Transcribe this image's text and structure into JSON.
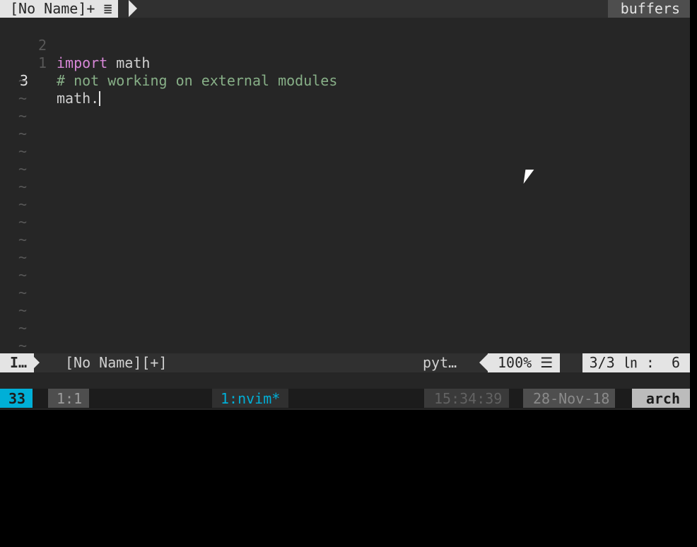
{
  "tabline": {
    "active_tab": "[No Name]+ ≣",
    "right_label": "buffers"
  },
  "editor": {
    "lines": [
      {
        "num": "2",
        "keyword": "import",
        "rest": " math",
        "comment": ""
      },
      {
        "num": "1",
        "keyword": "",
        "rest": "",
        "comment": "# not working on external modules"
      },
      {
        "num": "3",
        "keyword": "",
        "rest": "math.",
        "comment": ""
      }
    ],
    "tilde": "~"
  },
  "statusline": {
    "mode": "I…",
    "filename": "[No Name][+]",
    "filetype": "pyt…",
    "percent": "100% ☰",
    "position": "3/3 ㏑ :  6"
  },
  "tmux": {
    "session": "33",
    "pane_pos": "1:1",
    "window": "1:nvim*",
    "time": "15:34:39",
    "date": "28-Nov-18",
    "host": "arch"
  }
}
